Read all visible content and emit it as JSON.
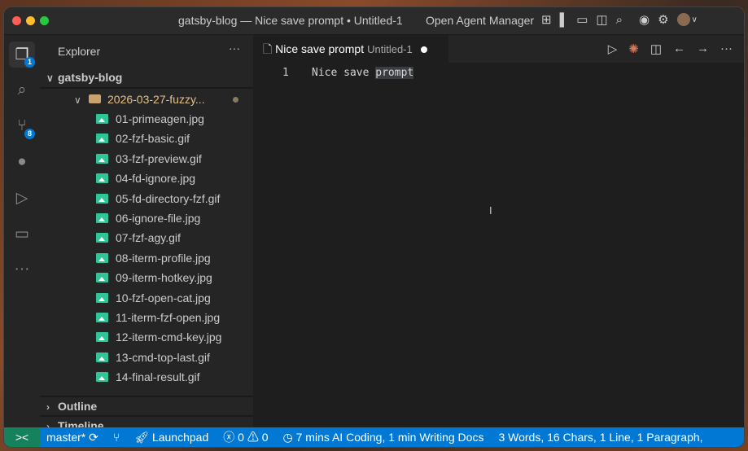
{
  "window": {
    "title": "gatsby-blog — Nice save prompt • Untitled-1",
    "agent_manager": "Open Agent Manager"
  },
  "activity": {
    "explorer_badge": "1",
    "scm_badge": "8"
  },
  "sidebar": {
    "title": "Explorer",
    "more": "···",
    "root": "gatsby-blog",
    "folder": "2026-03-27-fuzzy...",
    "files": [
      "01-primeagen.jpg",
      "02-fzf-basic.gif",
      "03-fzf-preview.gif",
      "04-fd-ignore.jpg",
      "05-fd-directory-fzf.gif",
      "06-ignore-file.jpg",
      "07-fzf-agy.gif",
      "08-iterm-profile.jpg",
      "09-iterm-hotkey.jpg",
      "10-fzf-open-cat.jpg",
      "11-iterm-fzf-open.jpg",
      "12-iterm-cmd-key.jpg",
      "13-cmd-top-last.gif",
      "14-final-result.gif"
    ],
    "outline": "Outline",
    "timeline": "Timeline"
  },
  "editor": {
    "tab_title": "Nice save prompt",
    "tab_sub": "Untitled-1",
    "line_number": "1",
    "code_pre": "Nice save ",
    "code_sel": "prompt"
  },
  "status": {
    "branch": "master*",
    "launchpad": "Launchpad",
    "errors": "0",
    "warnings": "0",
    "time": "7 mins AI Coding, 1 min Writing Docs",
    "stats": "3 Words, 16 Chars, 1 Line, 1 Paragraph,"
  },
  "colors": {
    "status_bar": "#0078d4",
    "remote": "#16825d",
    "folder": "#e2c08d",
    "image_icon": "#2fc598"
  }
}
